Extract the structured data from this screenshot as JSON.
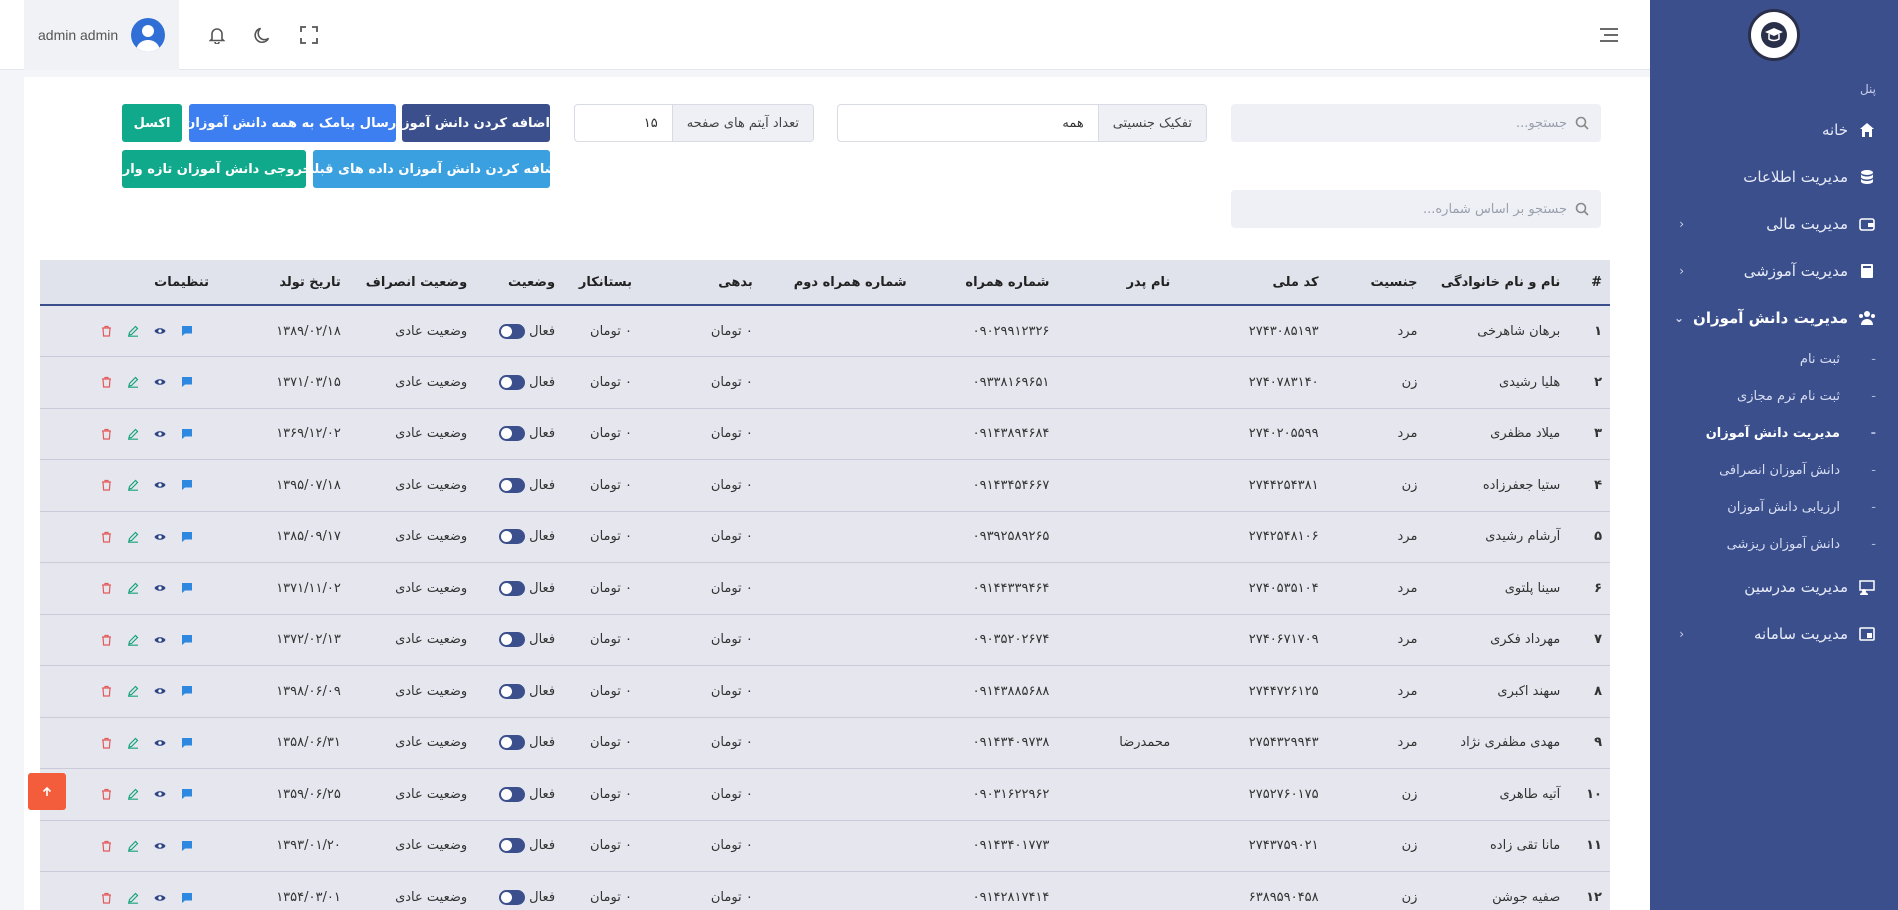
{
  "user": {
    "name": "admin admin"
  },
  "sidebar": {
    "panel_label": "پنل",
    "items": [
      {
        "label": "خانه",
        "icon": "home-icon"
      },
      {
        "label": "مدیریت اطلاعات",
        "icon": "database-icon"
      },
      {
        "label": "مدیریت مالی",
        "icon": "wallet-icon"
      },
      {
        "label": "مدیریت آموزشی",
        "icon": "book-icon"
      },
      {
        "label": "مدیریت دانش آموزان",
        "icon": "students-icon"
      },
      {
        "label": "مدیریت مدرسین",
        "icon": "teacher-icon"
      },
      {
        "label": "مدیریت سامانه",
        "icon": "system-icon"
      }
    ],
    "subitems": [
      {
        "label": "ثبت نام"
      },
      {
        "label": "ثبت نام ترم مجازی"
      },
      {
        "label": "مدیریت دانش آموزان"
      },
      {
        "label": "دانش آموزان انصرافی"
      },
      {
        "label": "ارزیابی دانش آموزان"
      },
      {
        "label": "دانش آموزان ریزشی"
      }
    ]
  },
  "filters": {
    "search_placeholder": "جستجو...",
    "search_number_placeholder": "جستجو بر اساس شماره...",
    "gender_label": "تفکیک جنسیتی",
    "gender_value": "همه",
    "per_page_label": "تعداد آیتم های صفحه",
    "per_page_value": "۱۵"
  },
  "buttons": {
    "add_student": "اضافه کردن دانش آموز",
    "sms_all": "ارسال پیامک به همه دانش آموزان",
    "excel": "اکسل",
    "add_previous": "اضافه کردن دانش آموزان داده های قبلی",
    "export_new": "خروجی دانش آموزان تازه وارد"
  },
  "table": {
    "headers": [
      "#",
      "نام و نام خانوادگی",
      "جنسیت",
      "کد ملی",
      "نام پدر",
      "شماره همراه",
      "شماره همراه دوم",
      "بدهی",
      "بستانکار",
      "وضعیت",
      "وضعیت انصراف",
      "تاریخ تولد",
      "تنظیمات"
    ],
    "rows": [
      [
        "۱",
        "برهان شاهرخی",
        "مرد",
        "۲۷۴۳۰۸۵۱۹۳",
        "",
        "۰۹۰۲۹۹۱۲۳۲۶",
        "",
        "۰ تومان",
        "۰ تومان",
        "فعال",
        "وضعیت عادی",
        "۱۳۸۹/۰۲/۱۸"
      ],
      [
        "۲",
        "هلیا رشیدی",
        "زن",
        "۲۷۴۰۷۸۳۱۴۰",
        "",
        "۰۹۳۳۸۱۶۹۶۵۱",
        "",
        "۰ تومان",
        "۰ تومان",
        "فعال",
        "وضعیت عادی",
        "۱۳۷۱/۰۳/۱۵"
      ],
      [
        "۳",
        "میلاد مظفری",
        "مرد",
        "۲۷۴۰۲۰۵۵۹۹",
        "",
        "۰۹۱۴۳۸۹۴۶۸۴",
        "",
        "۰ تومان",
        "۰ تومان",
        "فعال",
        "وضعیت عادی",
        "۱۳۶۹/۱۲/۰۲"
      ],
      [
        "۴",
        "ستیا جعفرزاده",
        "زن",
        "۲۷۴۴۲۵۴۳۸۱",
        "",
        "۰۹۱۴۳۴۵۴۶۶۷",
        "",
        "۰ تومان",
        "۰ تومان",
        "فعال",
        "وضعیت عادی",
        "۱۳۹۵/۰۷/۱۸"
      ],
      [
        "۵",
        "آرشام رشیدی",
        "مرد",
        "۲۷۴۲۵۴۸۱۰۶",
        "",
        "۰۹۳۹۲۵۸۹۲۶۵",
        "",
        "۰ تومان",
        "۰ تومان",
        "فعال",
        "وضعیت عادی",
        "۱۳۸۵/۰۹/۱۷"
      ],
      [
        "۶",
        "سینا پلتوی",
        "مرد",
        "۲۷۴۰۵۳۵۱۰۴",
        "",
        "۰۹۱۴۴۳۳۹۴۶۴",
        "",
        "۰ تومان",
        "۰ تومان",
        "فعال",
        "وضعیت عادی",
        "۱۳۷۱/۱۱/۰۲"
      ],
      [
        "۷",
        "مهرداد فکری",
        "مرد",
        "۲۷۴۰۶۷۱۷۰۹",
        "",
        "۰۹۰۳۵۲۰۲۶۷۴",
        "",
        "۰ تومان",
        "۰ تومان",
        "فعال",
        "وضعیت عادی",
        "۱۳۷۲/۰۲/۱۳"
      ],
      [
        "۸",
        "سهند اکبری",
        "مرد",
        "۲۷۴۴۷۲۶۱۲۵",
        "",
        "۰۹۱۴۳۸۸۵۶۸۸",
        "",
        "۰ تومان",
        "۰ تومان",
        "فعال",
        "وضعیت عادی",
        "۱۳۹۸/۰۶/۰۹"
      ],
      [
        "۹",
        "مهدی مظفری نژاد",
        "مرد",
        "۲۷۵۴۳۲۹۹۴۳",
        "محمدرضا",
        "۰۹۱۴۳۴۰۹۷۳۸",
        "",
        "۰ تومان",
        "۰ تومان",
        "فعال",
        "وضعیت عادی",
        "۱۳۵۸/۰۶/۳۱"
      ],
      [
        "۱۰",
        "آتیه طاهری",
        "زن",
        "۲۷۵۲۷۶۰۱۷۵",
        "",
        "۰۹۰۳۱۶۲۲۹۶۲",
        "",
        "۰ تومان",
        "۰ تومان",
        "فعال",
        "وضعیت عادی",
        "۱۳۵۹/۰۶/۲۵"
      ],
      [
        "۱۱",
        "مانا تقی زاده",
        "زن",
        "۲۷۴۳۷۵۹۰۲۱",
        "",
        "۰۹۱۴۳۴۰۱۷۷۳",
        "",
        "۰ تومان",
        "۰ تومان",
        "فعال",
        "وضعیت عادی",
        "۱۳۹۳/۰۱/۲۰"
      ],
      [
        "۱۲",
        "صفیه جوشن",
        "زن",
        "۶۳۸۹۵۹۰۴۵۸",
        "",
        "۰۹۱۴۲۸۱۷۴۱۴",
        "",
        "۰ تومان",
        "۰ تومان",
        "فعال",
        "وضعیت عادی",
        "۱۳۵۴/۰۳/۰۱"
      ]
    ]
  }
}
